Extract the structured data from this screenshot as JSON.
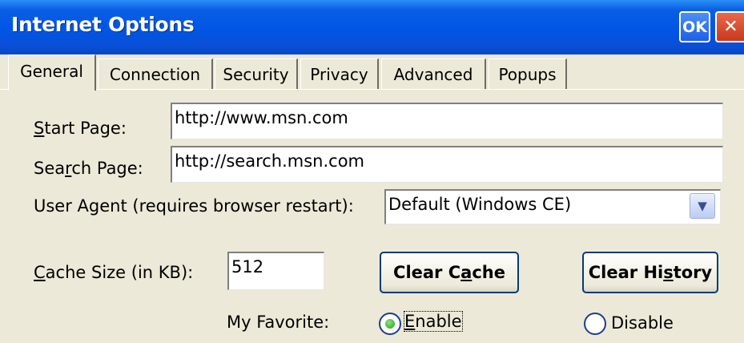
{
  "window": {
    "title": "Internet Options",
    "ok_label": "OK",
    "close_label": "✕"
  },
  "tabs": [
    {
      "label": "General",
      "active": true
    },
    {
      "label": "Connection",
      "active": false
    },
    {
      "label": "Security",
      "active": false
    },
    {
      "label": "Privacy",
      "active": false
    },
    {
      "label": "Advanced",
      "active": false
    },
    {
      "label": "Popups",
      "active": false
    }
  ],
  "general": {
    "start_page": {
      "label_pre": "",
      "label_u": "S",
      "label_post": "tart Page:",
      "value": "http://www.msn.com"
    },
    "search_page": {
      "label_pre": "Sea",
      "label_u": "r",
      "label_post": "ch Page:",
      "value": "http://search.msn.com"
    },
    "user_agent": {
      "label": "User Agent (requires browser restart):",
      "value": "Default (Windows CE)"
    },
    "cache": {
      "label_pre": "",
      "label_u": "C",
      "label_post": "ache Size (in KB):",
      "value": "512"
    },
    "clear_cache": {
      "pre": "Clear C",
      "u": "a",
      "post": "che"
    },
    "clear_history": {
      "pre": "Clear Hi",
      "u": "s",
      "post": "tory"
    },
    "favorite": {
      "label": "My Favorite:",
      "enable": {
        "pre": "",
        "u": "E",
        "post": "nable",
        "selected": true
      },
      "disable": {
        "label": "Disable",
        "selected": false
      }
    }
  },
  "colors": {
    "titlebar": "#0055E5",
    "dialog_bg": "#ECE9D8",
    "radio_selected": "#21A121"
  }
}
